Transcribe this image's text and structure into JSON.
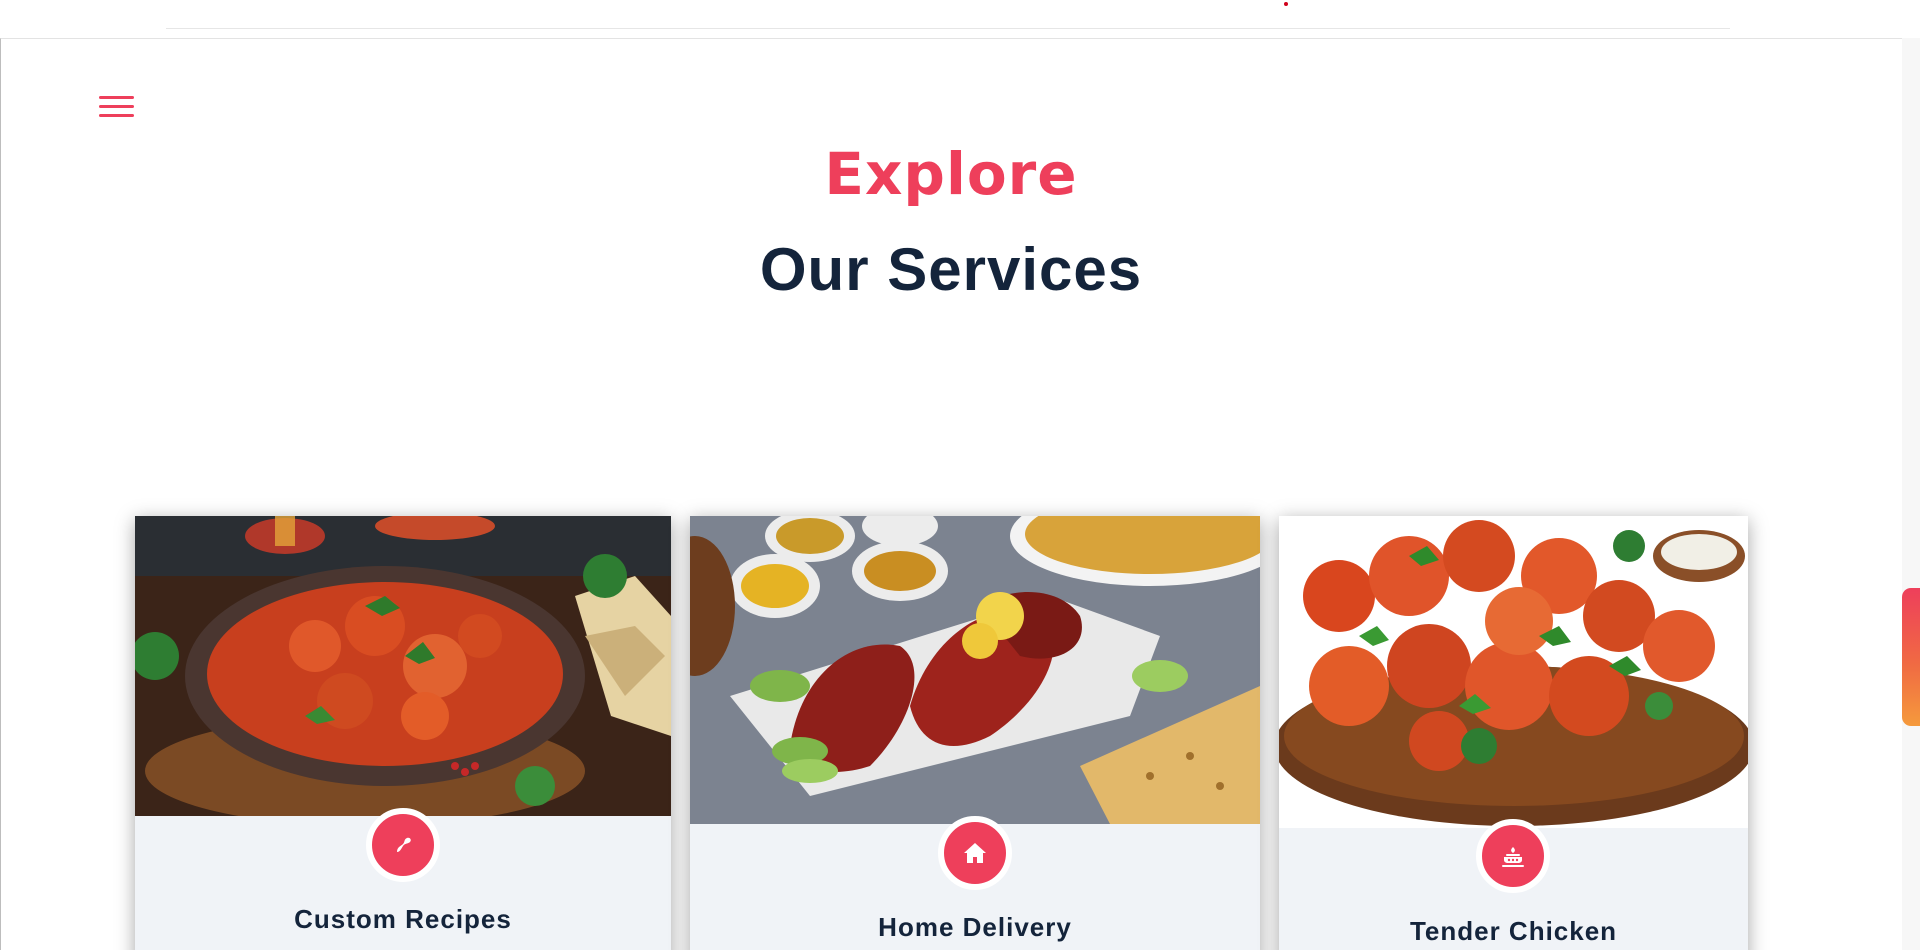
{
  "header": {
    "menu_icon": "hamburger-menu-icon"
  },
  "section": {
    "eyebrow": "Explore",
    "title": "Our Services"
  },
  "services": [
    {
      "title": "Custom Recipes",
      "icon": "recipe-icon",
      "image": "butter chicken curry bowl with naan"
    },
    {
      "title": "Home Delivery",
      "icon": "home-icon",
      "image": "tandoori chicken platter with rice and sauces"
    },
    {
      "title": "Tender Chicken",
      "icon": "cooking-pot-icon",
      "image": "grilled chicken skewers on wooden board"
    }
  ],
  "colors": {
    "accent": "#ee3f5b",
    "title": "#14243b",
    "card_bg": "#f0f3f7"
  }
}
